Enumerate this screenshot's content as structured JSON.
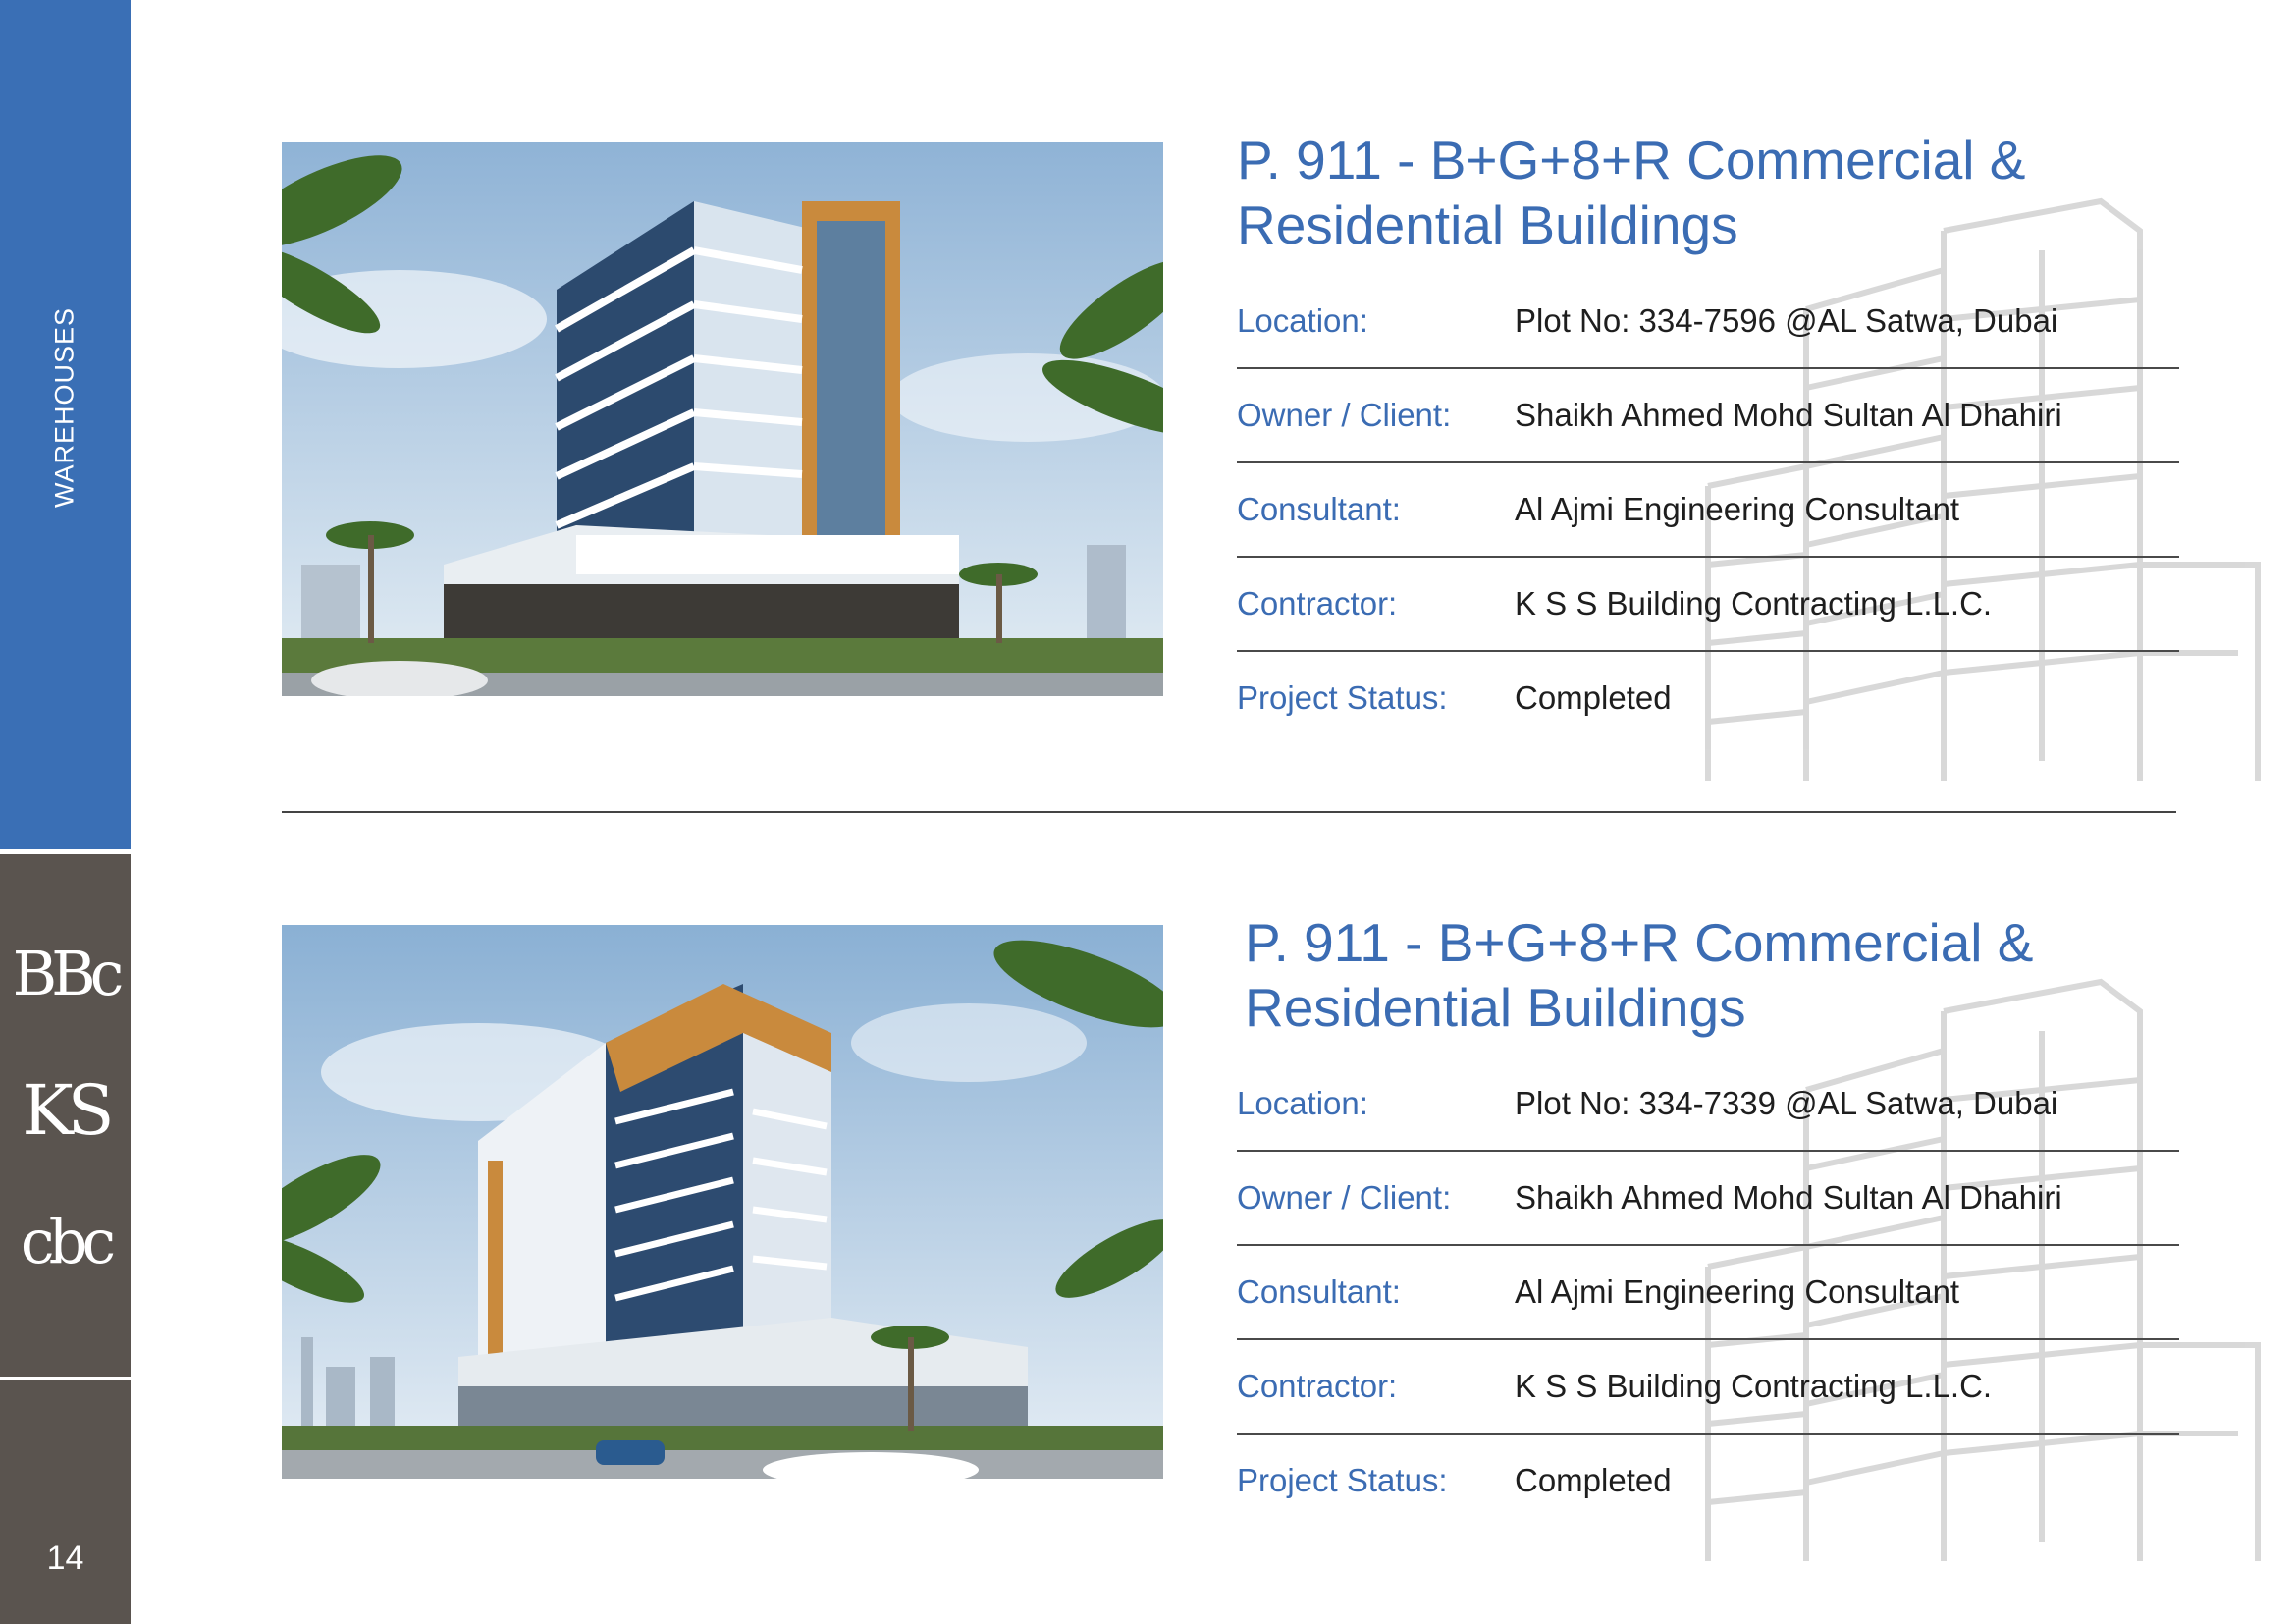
{
  "sidebar": {
    "section_label": "WAREHOUSES",
    "logos": [
      "BBc",
      "KS",
      "cbc"
    ],
    "page_number": "14"
  },
  "labels": {
    "location": "Location:",
    "owner": "Owner / Client:",
    "consultant": "Consultant:",
    "contractor": "Contractor:",
    "status": "Project Status:"
  },
  "projects": [
    {
      "title_line1": "P. 911 - B+G+8+R Commercial &",
      "title_line2": "Residential Buildings",
      "location": "Plot No: 334-7596 @AL Satwa, Dubai",
      "owner": "Shaikh Ahmed Mohd Sultan Al Dhahiri",
      "consultant": "Al Ajmi Engineering Consultant",
      "contractor": "K S S Building Contracting L.L.C.",
      "status": "Completed"
    },
    {
      "title_line1": "P. 911 - B+G+8+R Commercial &",
      "title_line2": "Residential Buildings",
      "location": "Plot No: 334-7339 @AL Satwa, Dubai",
      "owner": "Shaikh Ahmed Mohd Sultan Al Dhahiri",
      "consultant": "Al Ajmi Engineering Consultant",
      "contractor": "K S S Building Contracting L.L.C.",
      "status": "Completed"
    }
  ],
  "colors": {
    "accent_blue": "#3b6cb3",
    "sidebar_blue": "#3a6fb5",
    "sidebar_gray": "#5a544f"
  }
}
